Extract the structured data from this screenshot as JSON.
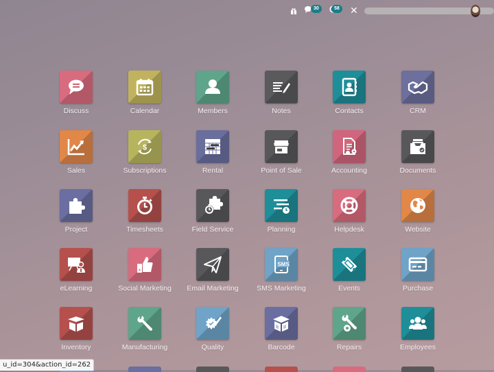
{
  "topbar": {
    "gift_icon": "gift-icon",
    "chat_icon": "chat-icon",
    "chat_count": "30",
    "activity_icon": "clock-icon",
    "activity_count": "58",
    "tools_icon": "tools-icon",
    "avatar_icon": "user-avatar"
  },
  "apps": [
    {
      "label": "Discuss",
      "icon": "chat-bubble-icon",
      "color": "#d96b7e"
    },
    {
      "label": "Calendar",
      "icon": "calendar-icon",
      "color": "#c1b35d"
    },
    {
      "label": "Members",
      "icon": "user-icon",
      "color": "#5fa58b"
    },
    {
      "label": "Notes",
      "icon": "notes-icon",
      "color": "#5a5a5c"
    },
    {
      "label": "Contacts",
      "icon": "address-book-icon",
      "color": "#1e8e99"
    },
    {
      "label": "CRM",
      "icon": "handshake-icon",
      "color": "#6d6f9c"
    },
    {
      "label": "Sales",
      "icon": "chart-line-icon",
      "color": "#e18748"
    },
    {
      "label": "Subscriptions",
      "icon": "recurring-dollar-icon",
      "color": "#b7b45e"
    },
    {
      "label": "Rental",
      "icon": "rental-grid-icon",
      "color": "#6a6e9d"
    },
    {
      "label": "Point of Sale",
      "icon": "store-icon",
      "color": "#58585a"
    },
    {
      "label": "Accounting",
      "icon": "invoice-gear-icon",
      "color": "#d0667d"
    },
    {
      "label": "Documents",
      "icon": "document-tray-icon",
      "color": "#58585a"
    },
    {
      "label": "Project",
      "icon": "puzzle-icon",
      "color": "#6a6ea0"
    },
    {
      "label": "Timesheets",
      "icon": "stopwatch-icon",
      "color": "#b5504d"
    },
    {
      "label": "Field Service",
      "icon": "puzzle-clock-icon",
      "color": "#58585a"
    },
    {
      "label": "Planning",
      "icon": "planning-icon",
      "color": "#1e8e99"
    },
    {
      "label": "Helpdesk",
      "icon": "lifebuoy-icon",
      "color": "#d96b7e"
    },
    {
      "label": "Website",
      "icon": "globe-icon",
      "color": "#e18748"
    },
    {
      "label": "eLearning",
      "icon": "teacher-board-icon",
      "color": "#b5504d"
    },
    {
      "label": "Social Marketing",
      "icon": "thumbs-up-icon",
      "color": "#d96b7e"
    },
    {
      "label": "Email Marketing",
      "icon": "paper-plane-icon",
      "color": "#58585a"
    },
    {
      "label": "SMS Marketing",
      "icon": "sms-phone-icon",
      "color": "#6fa3c7"
    },
    {
      "label": "Events",
      "icon": "ticket-icon",
      "color": "#1e8e99"
    },
    {
      "label": "Purchase",
      "icon": "credit-card-icon",
      "color": "#6fa3c7"
    },
    {
      "label": "Inventory",
      "icon": "box-icon",
      "color": "#b5504d"
    },
    {
      "label": "Manufacturing",
      "icon": "wrench-icon",
      "color": "#5fa58b"
    },
    {
      "label": "Quality",
      "icon": "quality-badge-icon",
      "color": "#6fa3c7"
    },
    {
      "label": "Barcode",
      "icon": "barcode-box-icon",
      "color": "#6a6ea0"
    },
    {
      "label": "Repairs",
      "icon": "wrench-gear-icon",
      "color": "#5fa58b"
    },
    {
      "label": "Employees",
      "icon": "users-icon",
      "color": "#1e8e99"
    }
  ],
  "partial_row_colors": [
    "#6fa3c7",
    "#6a6ea0",
    "#58585a",
    "#b5504d",
    "#d96b7e",
    "#58585a"
  ],
  "statusbar": {
    "url_fragment": "u_id=304&action_id=262"
  }
}
